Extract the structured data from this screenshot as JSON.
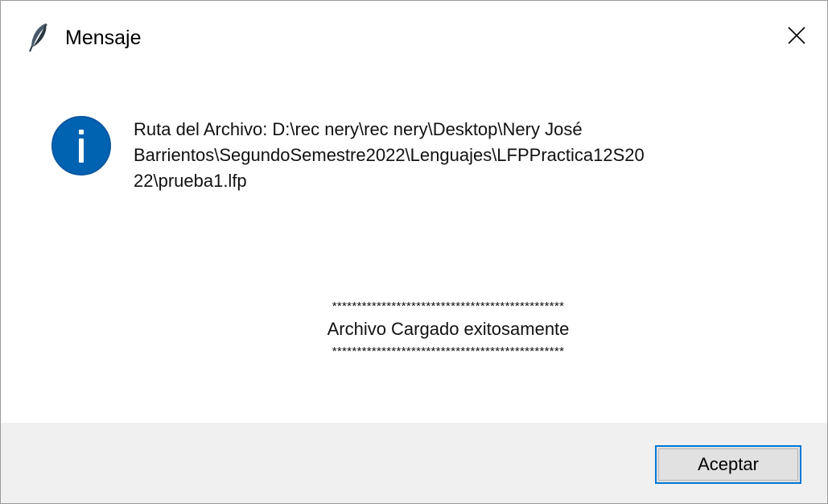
{
  "window": {
    "title": "Mensaje",
    "app_icon": "feather-icon",
    "close_icon": "close-icon"
  },
  "message": {
    "icon": "info-icon",
    "icon_color": "#0063b1",
    "lines": [
      "Ruta del Archivo: D:\\rec nery\\rec nery\\Desktop\\Nery José",
      "Barrientos\\SegundoSemestre2022\\Lenguajes\\LFPPractica12S20",
      "22\\prueba1.lfp"
    ]
  },
  "status": {
    "stars_top": "***********************************************",
    "text": "Archivo Cargado exitosamente",
    "stars_bottom": "***********************************************"
  },
  "footer": {
    "ok_label": "Aceptar",
    "accent_color": "#0078d7"
  }
}
